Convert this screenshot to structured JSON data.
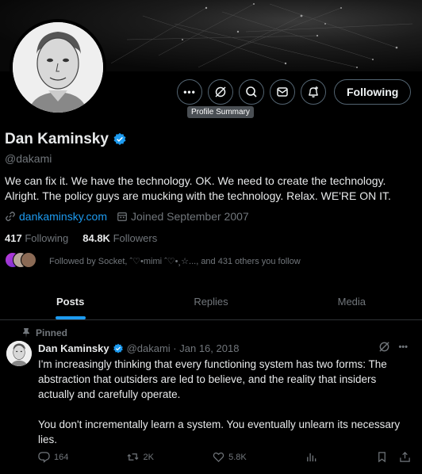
{
  "profile": {
    "name": "Dan Kaminsky",
    "handle": "@dakami",
    "bio": "We can fix it. We have the technology. OK. We need to create the technology. Alright. The policy guys are mucking with the technology. Relax. WE'RE ON IT.",
    "website": "dankaminsky.com",
    "joined": "Joined September 2007",
    "following_count": "417",
    "following_label": "Following",
    "followers_count": "84.8K",
    "followers_label": "Followers",
    "followed_by": "Followed by Socket, ˆ♡•mimi ˆ♡•¸☆..., and 431 others you follow"
  },
  "actions": {
    "follow_label": "Following",
    "tooltip": "Profile Summary",
    "icons": [
      "more-icon",
      "grok-icon",
      "search-icon",
      "message-icon",
      "notify-icon"
    ]
  },
  "tabs": [
    {
      "label": "Posts",
      "active": true
    },
    {
      "label": "Replies",
      "active": false
    },
    {
      "label": "Media",
      "active": false
    }
  ],
  "post": {
    "pinned_label": "Pinned",
    "author": "Dan Kaminsky",
    "meta": "@dakami · Jan 16, 2018",
    "paragraph1": "I'm increasingly thinking that every functioning system has two forms:  The abstraction that outsiders are led to believe, and the reality that insiders actually and carefully operate.",
    "paragraph2": "You don't incrementally learn a system.  You eventually unlearn its necessary lies.",
    "replies": "164",
    "reposts": "2K",
    "likes": "5.8K"
  },
  "colors": {
    "accent": "#1d9bf0",
    "muted": "#71767b",
    "text": "#e7e9ea",
    "background": "#000000"
  }
}
